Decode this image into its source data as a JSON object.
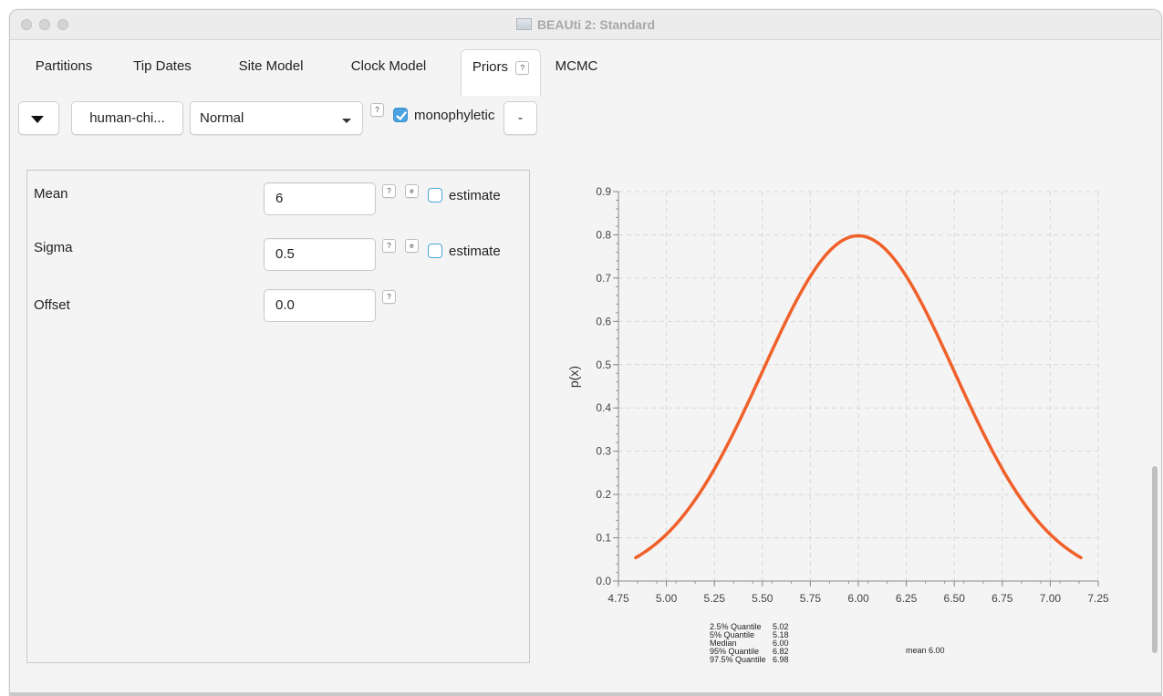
{
  "window": {
    "title": "BEAUti 2: Standard"
  },
  "tabs": [
    {
      "label": "Partitions",
      "active": false
    },
    {
      "label": "Tip Dates",
      "active": false
    },
    {
      "label": "Site Model",
      "active": false
    },
    {
      "label": "Clock Model",
      "active": false
    },
    {
      "label": "Priors",
      "active": true,
      "help": "?"
    },
    {
      "label": "MCMC",
      "active": false
    }
  ],
  "prior_row": {
    "taxon_set_label": "human-chi...",
    "distribution": "Normal",
    "help": "?",
    "monophyletic_label": "monophyletic",
    "monophyletic_checked": true,
    "remove_label": "-"
  },
  "params": [
    {
      "label": "Mean",
      "value": "6",
      "help": "?",
      "e": "e",
      "estimate_label": "estimate",
      "estimate_checked": false
    },
    {
      "label": "Sigma",
      "value": "0.5",
      "help": "?",
      "e": "e",
      "estimate_label": "estimate",
      "estimate_checked": false
    },
    {
      "label": "Offset",
      "value": "0.0",
      "help": "?"
    }
  ],
  "colors": {
    "curve": "#f0602a",
    "checkbox_accent": "#48a3e0"
  },
  "chart_data": {
    "type": "line",
    "ylabel": "p(x)",
    "xlim": [
      4.75,
      7.25
    ],
    "ylim": [
      0,
      0.9
    ],
    "xticks": [
      "4.75",
      "5.00",
      "5.25",
      "5.50",
      "5.75",
      "6.00",
      "6.25",
      "6.50",
      "6.75",
      "7.00",
      "7.25"
    ],
    "yticks": [
      "0.0",
      "0.1",
      "0.2",
      "0.3",
      "0.4",
      "0.5",
      "0.6",
      "0.7",
      "0.8",
      "0.9"
    ],
    "grid": true,
    "series": [
      {
        "distribution": "normal",
        "mean": 6,
        "sigma": 0.5,
        "x_range": [
          4.84,
          7.16
        ]
      }
    ],
    "stats": [
      {
        "label": "2.5% Quantile",
        "value": "5.02"
      },
      {
        "label": "5% Quantile",
        "value": "5.18"
      },
      {
        "label": "Median",
        "value": "6.00"
      },
      {
        "label": "95% Quantile",
        "value": "6.82"
      },
      {
        "label": "97.5% Quantile",
        "value": "6.98"
      }
    ],
    "mean_label": "mean 6.00"
  }
}
